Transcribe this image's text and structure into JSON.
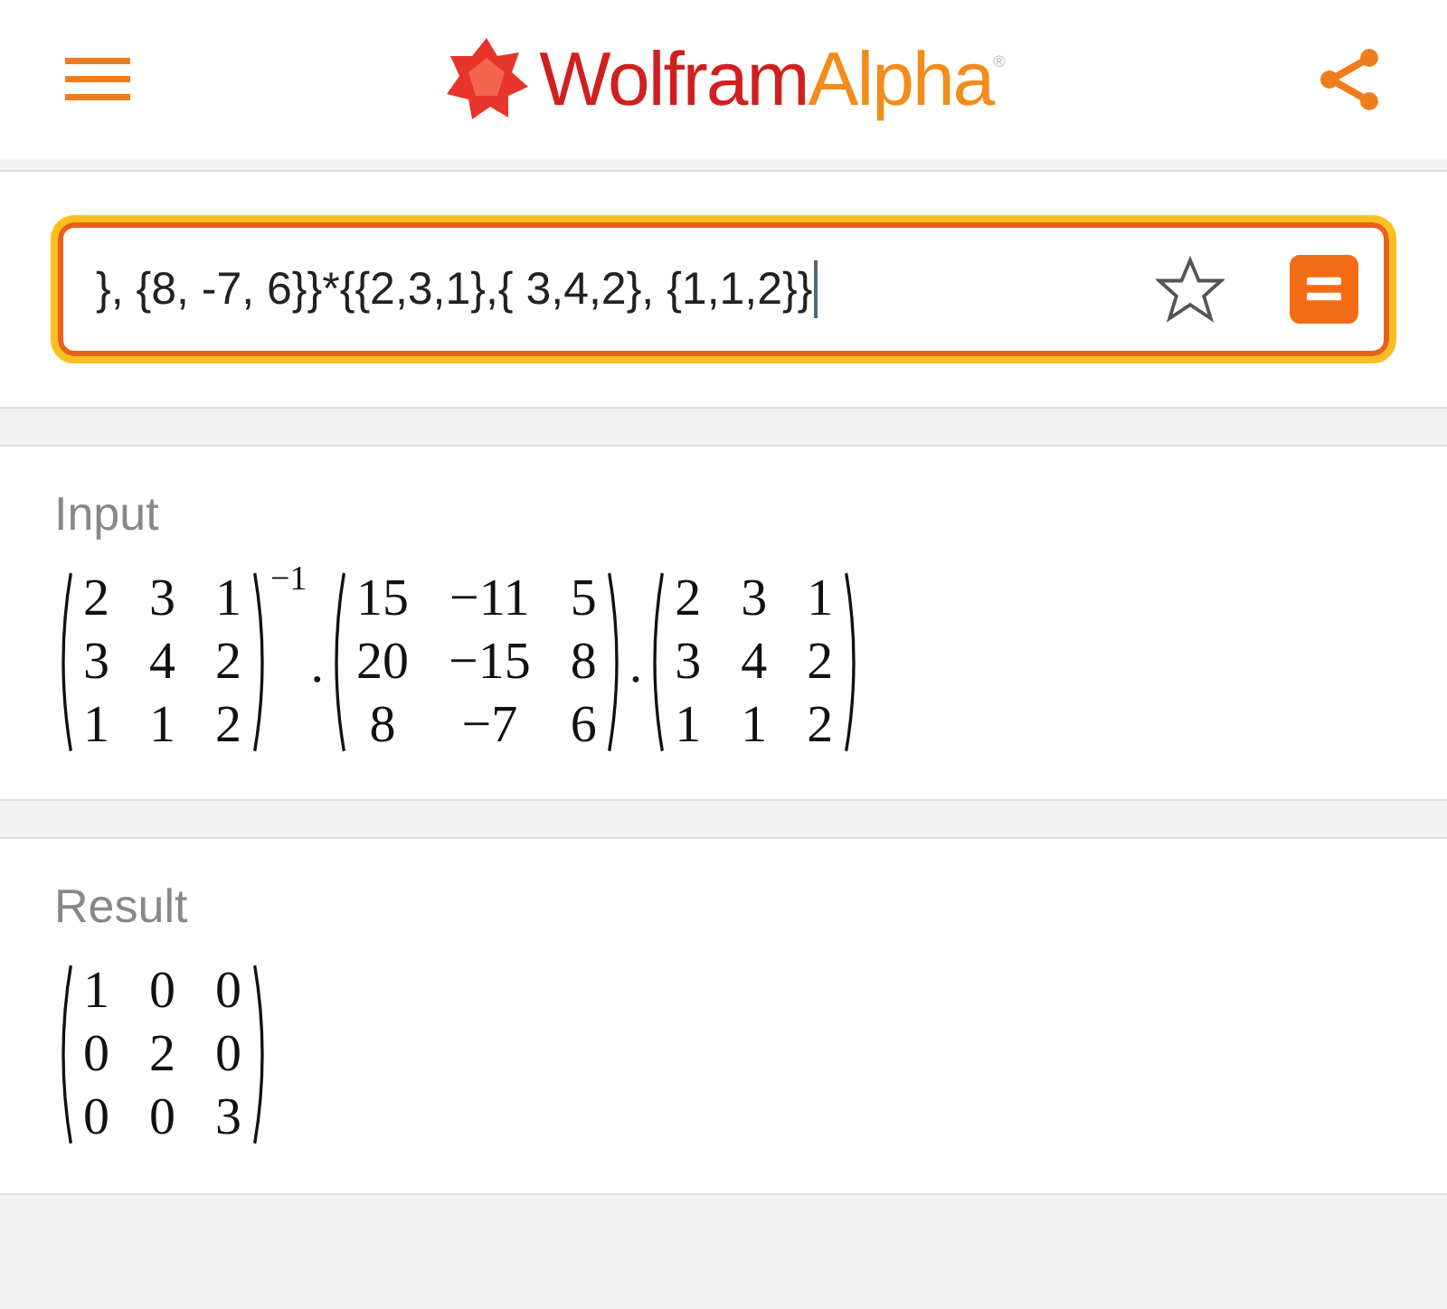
{
  "header": {
    "logo": {
      "first": "Wolfram",
      "second": "Alpha",
      "mark": "®"
    }
  },
  "search": {
    "value": "}, {8, -7, 6}}*{{2,3,1},{ 3,4,2}, {1,1,2}}",
    "favorited": false
  },
  "pods": [
    {
      "title": "Input",
      "expression": [
        {
          "kind": "matrix",
          "rows": [
            [
              "2",
              "3",
              "1"
            ],
            [
              "3",
              "4",
              "2"
            ],
            [
              "1",
              "1",
              "2"
            ]
          ],
          "superscript": "−1"
        },
        {
          "kind": "operator",
          "text": "."
        },
        {
          "kind": "matrix",
          "rows": [
            [
              "15",
              "−11",
              "5"
            ],
            [
              "20",
              "−15",
              "8"
            ],
            [
              "8",
              "−7",
              "6"
            ]
          ]
        },
        {
          "kind": "operator",
          "text": "."
        },
        {
          "kind": "matrix",
          "rows": [
            [
              "2",
              "3",
              "1"
            ],
            [
              "3",
              "4",
              "2"
            ],
            [
              "1",
              "1",
              "2"
            ]
          ]
        }
      ]
    },
    {
      "title": "Result",
      "expression": [
        {
          "kind": "matrix",
          "rows": [
            [
              "1",
              "0",
              "0"
            ],
            [
              "0",
              "2",
              "0"
            ],
            [
              "0",
              "0",
              "3"
            ]
          ]
        }
      ]
    }
  ]
}
